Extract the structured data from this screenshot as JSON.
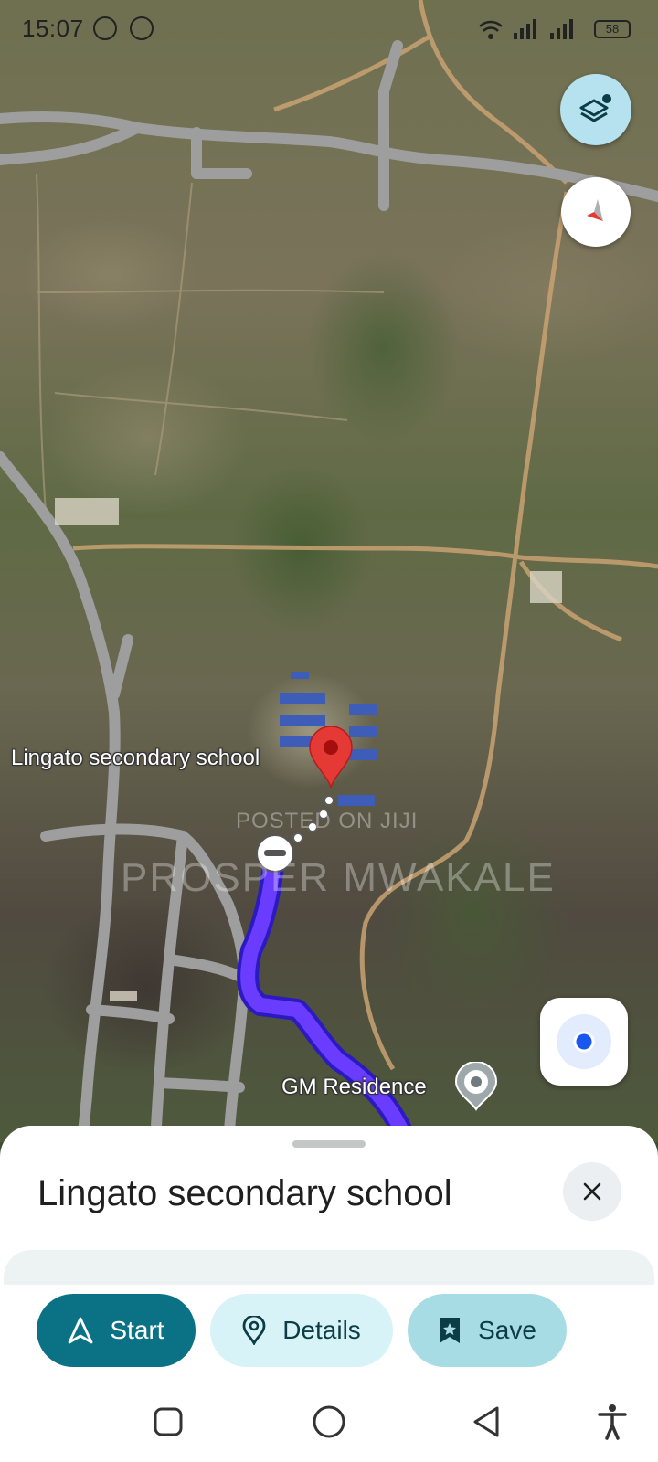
{
  "status_bar": {
    "time": "15:07",
    "icons": [
      "whatsapp-icon",
      "whatsapp-icon",
      "wifi-icon",
      "signal-icon",
      "signal-icon",
      "battery-icon"
    ],
    "battery_label": "58"
  },
  "map": {
    "labels": {
      "destination": "Lingato secondary school",
      "origin": "GM Residence"
    },
    "watermark": {
      "line1": "POSTED ON JIJI",
      "line2": "PROSPER MWAKALE"
    },
    "route_color": "#5b2cf0",
    "pin_color": "#e53935"
  },
  "place": {
    "title": "Lingato secondary school"
  },
  "actions": {
    "start": "Start",
    "details": "Details",
    "save": "Save"
  },
  "colors": {
    "start_bg": "#0b7285",
    "details_bg": "#d7f3f7",
    "save_bg": "#a8dce4",
    "layers_bg": "#b5e2ee"
  },
  "nav_bar": {
    "icons": [
      "recents-icon",
      "home-icon",
      "back-icon",
      "accessibility-icon"
    ]
  }
}
